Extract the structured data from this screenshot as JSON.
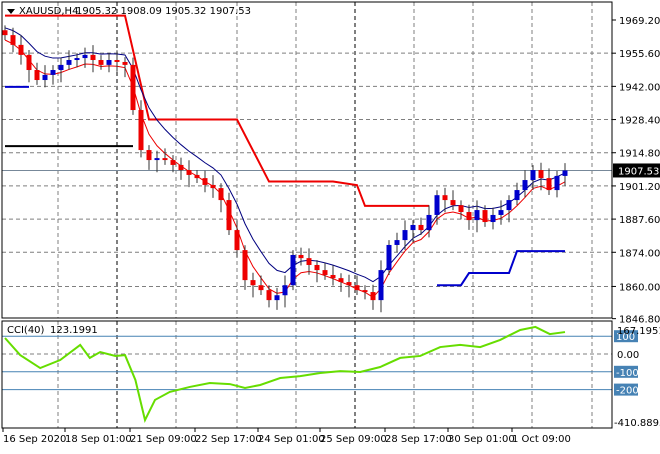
{
  "header": {
    "title": "XAUUSD,H4",
    "ohlc": "1905.32 1908.09 1905.32 1907.53"
  },
  "cci_header": {
    "title": "CCI(40)",
    "value": "123.1991"
  },
  "colors": {
    "bull": "#0000cc",
    "bear": "#ee0000",
    "grid": "#7f7f7f",
    "cci": "#66dd00",
    "level": "#4682b4"
  },
  "chart_data": [
    {
      "type": "candlestick",
      "title": "XAUUSD,H4",
      "ylim": [
        1846.8,
        1975
      ],
      "price_ticks": [
        "1969.20",
        "1955.60",
        "1942.00",
        "1928.40",
        "1914.80",
        "1901.20",
        "1887.60",
        "1874.00",
        "1860.00",
        "1846.80"
      ],
      "price_tick_values": [
        1969.2,
        1955.6,
        1942.0,
        1928.4,
        1914.8,
        1901.2,
        1887.6,
        1874.0,
        1860.0,
        1846.8
      ],
      "current_price": "1907.53",
      "x_labels": [
        "16 Sep 2020",
        "18 Sep 01:00",
        "21 Sep 09:00",
        "22 Sep 17:00",
        "24 Sep 01:00",
        "25 Sep 09:00",
        "28 Sep 17:00",
        "30 Sep 01:00",
        "1 Oct 09:00"
      ],
      "closes": [
        1963.0,
        1959.0,
        1954.9,
        1948.7,
        1944.6,
        1946.7,
        1948.7,
        1950.8,
        1952.8,
        1953.6,
        1954.9,
        1952.8,
        1950.8,
        1952.8,
        1952.0,
        1950.8,
        1932.3,
        1915.9,
        1911.8,
        1912.6,
        1911.8,
        1909.8,
        1907.7,
        1905.7,
        1904.4,
        1901.6,
        1900.3,
        1895.4,
        1883.1,
        1874.9,
        1862.6,
        1860.5,
        1858.5,
        1854.4,
        1856.4,
        1860.5,
        1872.9,
        1871.6,
        1868.8,
        1866.7,
        1864.7,
        1863.4,
        1861.8,
        1860.5,
        1858.5,
        1857.7,
        1854.4,
        1866.7,
        1877.0,
        1879.0,
        1883.1,
        1885.2,
        1883.1,
        1889.3,
        1897.4,
        1895.4,
        1893.3,
        1890.5,
        1887.2,
        1891.3,
        1886.4,
        1889.3,
        1891.3,
        1895.4,
        1899.5,
        1903.6,
        1907.7,
        1904.4,
        1899.5,
        1905.3,
        1907.53
      ],
      "upper_step": [
        [
          0,
          1971
        ],
        [
          15,
          1971
        ],
        [
          18,
          1928.4
        ],
        [
          29,
          1928.4
        ],
        [
          33,
          1903
        ],
        [
          41,
          1903
        ],
        [
          44,
          1901.5
        ],
        [
          45,
          1893
        ],
        [
          53,
          1893
        ]
      ],
      "lower_step": [
        [
          0,
          1941.8
        ],
        [
          3,
          1941.8
        ]
      ],
      "lower_step2": [
        [
          54,
          1860.5
        ],
        [
          57,
          1860.5
        ],
        [
          58,
          1865.5
        ],
        [
          63,
          1865.5
        ],
        [
          64,
          1874.5
        ],
        [
          70,
          1874.5
        ]
      ],
      "black_level": [
        [
          0,
          1917.5
        ],
        [
          16,
          1917.5
        ]
      ]
    },
    {
      "type": "line",
      "title": "CCI(40)",
      "ylim": [
        -410.8893,
        230
      ],
      "levels": [
        "100",
        "-100",
        "-200"
      ],
      "level_values": [
        100,
        -100,
        -200
      ],
      "zero_label": "0.00",
      "max_label": "167.1951",
      "min_label": "-410.8893",
      "points": [
        [
          0,
          90
        ],
        [
          1.9,
          -6
        ],
        [
          4.4,
          -79
        ],
        [
          6.9,
          -34
        ],
        [
          9.4,
          51
        ],
        [
          10.6,
          -22
        ],
        [
          11.9,
          11
        ],
        [
          13.8,
          -11
        ],
        [
          15,
          -6
        ],
        [
          16.3,
          -146
        ],
        [
          17.5,
          -371
        ],
        [
          18.75,
          -258
        ],
        [
          20.6,
          -213
        ],
        [
          23.1,
          -185
        ],
        [
          25.6,
          -163
        ],
        [
          28.1,
          -169
        ],
        [
          30,
          -191
        ],
        [
          31.9,
          -174
        ],
        [
          34.4,
          -135
        ],
        [
          36.9,
          -124
        ],
        [
          39.4,
          -107
        ],
        [
          41.9,
          -96
        ],
        [
          44.4,
          -101
        ],
        [
          46.9,
          -73
        ],
        [
          49.4,
          -22
        ],
        [
          51.9,
          -11
        ],
        [
          54.4,
          39
        ],
        [
          56.9,
          51
        ],
        [
          59.4,
          39
        ],
        [
          61.9,
          79
        ],
        [
          64.4,
          135
        ],
        [
          66.3,
          152
        ],
        [
          68.1,
          112
        ],
        [
          70,
          123.2
        ]
      ]
    }
  ]
}
